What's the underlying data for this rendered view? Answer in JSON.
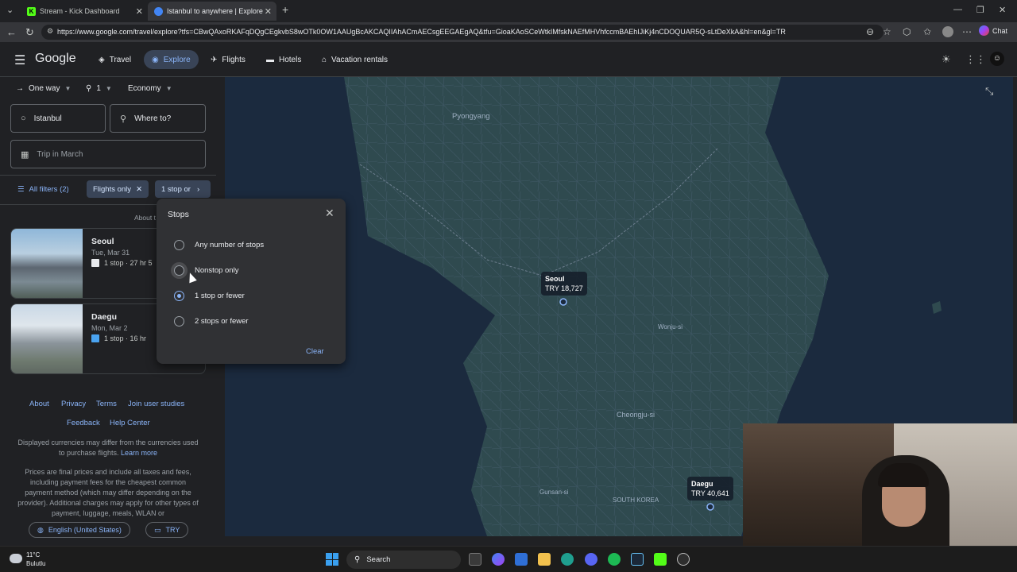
{
  "browser": {
    "tabs": [
      {
        "label": "Stream - Kick Dashboard",
        "favicon": "K"
      },
      {
        "label": "Istanbul to anywhere | Explore",
        "favicon": "G"
      }
    ],
    "url": "https://www.google.com/travel/explore?tfs=CBwQAxoRKAFqDQgCEgkvbS8wOTk0OW1AAUgBcAKCAQIIAhACmAECsgEEGAEgAQ&tfu=GioaKAoSCeWtkIMfskNAEfMHVhfccmBAEhIJiKj4nCDOQUAR5Q-sLtDeXkA&hl=en&gl=TR",
    "chat_label": "Chat"
  },
  "header": {
    "logo": "Google",
    "nav": [
      {
        "label": "Travel",
        "icon": "travel-tag-icon"
      },
      {
        "label": "Explore",
        "icon": "explore-icon"
      },
      {
        "label": "Flights",
        "icon": "flight-icon"
      },
      {
        "label": "Hotels",
        "icon": "hotel-icon"
      },
      {
        "label": "Vacation rentals",
        "icon": "home-icon"
      }
    ]
  },
  "search": {
    "trip_type": "One way",
    "passengers": "1",
    "cabin": "Economy",
    "origin": "Istanbul",
    "destination_placeholder": "Where to?",
    "dates": "Trip in March"
  },
  "filters": {
    "all_filters": "All filters (2)",
    "flights_only": "Flights only",
    "stops_chip": "1 stop or"
  },
  "results": {
    "about_partial": "About t",
    "cards": [
      {
        "city": "Seoul",
        "date": "Tue, Mar 31",
        "stops": "1 stop · 27 hr 5"
      },
      {
        "city": "Daegu",
        "date": "Mon, Mar 2",
        "stops": "1 stop · 16 hr"
      }
    ]
  },
  "footer": {
    "links": [
      "About",
      "Privacy",
      "Terms",
      "Join user studies"
    ],
    "links2": [
      "Feedback",
      "Help Center"
    ],
    "currency_note": "Displayed currencies may differ from the currencies used to purchase flights.",
    "learn_more": "Learn more",
    "price_note": "Prices are final prices and include all taxes and fees, including payment fees for the cheapest common payment method (which may differ depending on the provider). Additional charges may apply for other types of payment, luggage, meals, WLAN or",
    "language": "English (United States)",
    "currency": "TRY"
  },
  "stops_popup": {
    "title": "Stops",
    "options": [
      "Any number of stops",
      "Nonstop only",
      "1 stop or fewer",
      "2 stops or fewer"
    ],
    "selected_index": 2,
    "clear": "Clear"
  },
  "map": {
    "labels": [
      "Pyongyang",
      "Wonju-si",
      "Cheongju-si",
      "SOUTH KOREA",
      "Gunsan-si"
    ],
    "prices": [
      {
        "city": "Seoul",
        "price": "TRY 18,727"
      },
      {
        "city": "Daegu",
        "price": "TRY 40,641"
      }
    ]
  },
  "taskbar": {
    "temperature": "11°C",
    "condition": "Bulutlu",
    "search": "Search"
  }
}
